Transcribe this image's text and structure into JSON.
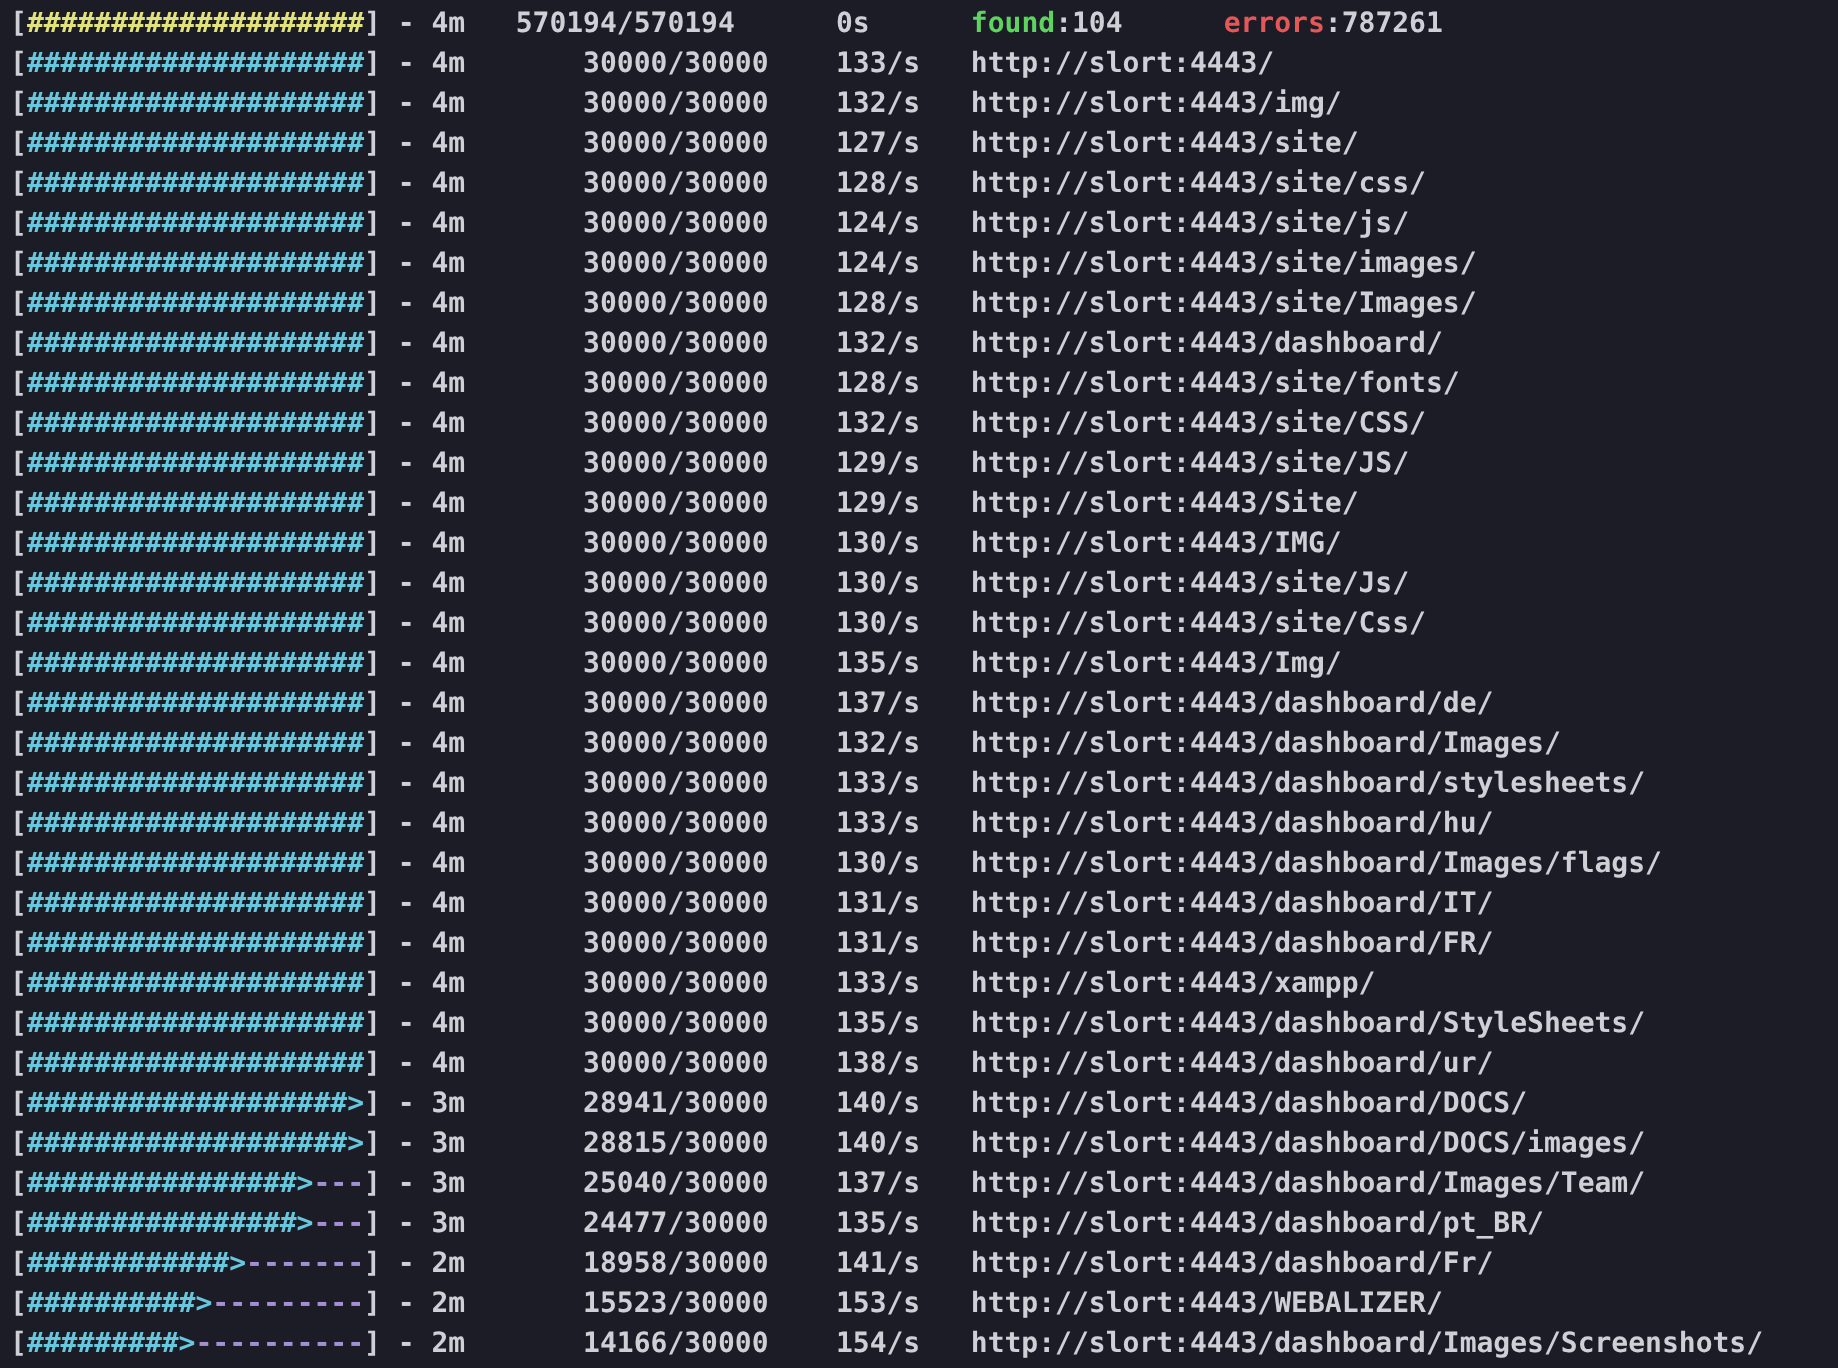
{
  "summary": {
    "open": "[",
    "fill": "####################",
    "close": "]",
    "sep": "-",
    "elapsed": "4m",
    "progress": "570194/570194",
    "rate": "0s",
    "found_label": "found",
    "found_value": ":104",
    "errors_label": "errors",
    "errors_value": ":787261"
  },
  "scans": [
    {
      "open": "[",
      "fill": "####################",
      "close": "]",
      "sep": "-",
      "elapsed": "4m",
      "progress": "30000/30000",
      "rate": "133/s",
      "url": "http://slort:4443/"
    },
    {
      "open": "[",
      "fill": "####################",
      "close": "]",
      "sep": "-",
      "elapsed": "4m",
      "progress": "30000/30000",
      "rate": "132/s",
      "url": "http://slort:4443/img/"
    },
    {
      "open": "[",
      "fill": "####################",
      "close": "]",
      "sep": "-",
      "elapsed": "4m",
      "progress": "30000/30000",
      "rate": "127/s",
      "url": "http://slort:4443/site/"
    },
    {
      "open": "[",
      "fill": "####################",
      "close": "]",
      "sep": "-",
      "elapsed": "4m",
      "progress": "30000/30000",
      "rate": "128/s",
      "url": "http://slort:4443/site/css/"
    },
    {
      "open": "[",
      "fill": "####################",
      "close": "]",
      "sep": "-",
      "elapsed": "4m",
      "progress": "30000/30000",
      "rate": "124/s",
      "url": "http://slort:4443/site/js/"
    },
    {
      "open": "[",
      "fill": "####################",
      "close": "]",
      "sep": "-",
      "elapsed": "4m",
      "progress": "30000/30000",
      "rate": "124/s",
      "url": "http://slort:4443/site/images/"
    },
    {
      "open": "[",
      "fill": "####################",
      "close": "]",
      "sep": "-",
      "elapsed": "4m",
      "progress": "30000/30000",
      "rate": "128/s",
      "url": "http://slort:4443/site/Images/"
    },
    {
      "open": "[",
      "fill": "####################",
      "close": "]",
      "sep": "-",
      "elapsed": "4m",
      "progress": "30000/30000",
      "rate": "132/s",
      "url": "http://slort:4443/dashboard/"
    },
    {
      "open": "[",
      "fill": "####################",
      "close": "]",
      "sep": "-",
      "elapsed": "4m",
      "progress": "30000/30000",
      "rate": "128/s",
      "url": "http://slort:4443/site/fonts/"
    },
    {
      "open": "[",
      "fill": "####################",
      "close": "]",
      "sep": "-",
      "elapsed": "4m",
      "progress": "30000/30000",
      "rate": "132/s",
      "url": "http://slort:4443/site/CSS/"
    },
    {
      "open": "[",
      "fill": "####################",
      "close": "]",
      "sep": "-",
      "elapsed": "4m",
      "progress": "30000/30000",
      "rate": "129/s",
      "url": "http://slort:4443/site/JS/"
    },
    {
      "open": "[",
      "fill": "####################",
      "close": "]",
      "sep": "-",
      "elapsed": "4m",
      "progress": "30000/30000",
      "rate": "129/s",
      "url": "http://slort:4443/Site/"
    },
    {
      "open": "[",
      "fill": "####################",
      "close": "]",
      "sep": "-",
      "elapsed": "4m",
      "progress": "30000/30000",
      "rate": "130/s",
      "url": "http://slort:4443/IMG/"
    },
    {
      "open": "[",
      "fill": "####################",
      "close": "]",
      "sep": "-",
      "elapsed": "4m",
      "progress": "30000/30000",
      "rate": "130/s",
      "url": "http://slort:4443/site/Js/"
    },
    {
      "open": "[",
      "fill": "####################",
      "close": "]",
      "sep": "-",
      "elapsed": "4m",
      "progress": "30000/30000",
      "rate": "130/s",
      "url": "http://slort:4443/site/Css/"
    },
    {
      "open": "[",
      "fill": "####################",
      "close": "]",
      "sep": "-",
      "elapsed": "4m",
      "progress": "30000/30000",
      "rate": "135/s",
      "url": "http://slort:4443/Img/"
    },
    {
      "open": "[",
      "fill": "####################",
      "close": "]",
      "sep": "-",
      "elapsed": "4m",
      "progress": "30000/30000",
      "rate": "137/s",
      "url": "http://slort:4443/dashboard/de/"
    },
    {
      "open": "[",
      "fill": "####################",
      "close": "]",
      "sep": "-",
      "elapsed": "4m",
      "progress": "30000/30000",
      "rate": "132/s",
      "url": "http://slort:4443/dashboard/Images/"
    },
    {
      "open": "[",
      "fill": "####################",
      "close": "]",
      "sep": "-",
      "elapsed": "4m",
      "progress": "30000/30000",
      "rate": "133/s",
      "url": "http://slort:4443/dashboard/stylesheets/"
    },
    {
      "open": "[",
      "fill": "####################",
      "close": "]",
      "sep": "-",
      "elapsed": "4m",
      "progress": "30000/30000",
      "rate": "133/s",
      "url": "http://slort:4443/dashboard/hu/"
    },
    {
      "open": "[",
      "fill": "####################",
      "close": "]",
      "sep": "-",
      "elapsed": "4m",
      "progress": "30000/30000",
      "rate": "130/s",
      "url": "http://slort:4443/dashboard/Images/flags/"
    },
    {
      "open": "[",
      "fill": "####################",
      "close": "]",
      "sep": "-",
      "elapsed": "4m",
      "progress": "30000/30000",
      "rate": "131/s",
      "url": "http://slort:4443/dashboard/IT/"
    },
    {
      "open": "[",
      "fill": "####################",
      "close": "]",
      "sep": "-",
      "elapsed": "4m",
      "progress": "30000/30000",
      "rate": "131/s",
      "url": "http://slort:4443/dashboard/FR/"
    },
    {
      "open": "[",
      "fill": "####################",
      "close": "]",
      "sep": "-",
      "elapsed": "4m",
      "progress": "30000/30000",
      "rate": "133/s",
      "url": "http://slort:4443/xampp/"
    },
    {
      "open": "[",
      "fill": "####################",
      "close": "]",
      "sep": "-",
      "elapsed": "4m",
      "progress": "30000/30000",
      "rate": "135/s",
      "url": "http://slort:4443/dashboard/StyleSheets/"
    },
    {
      "open": "[",
      "fill": "####################",
      "close": "]",
      "sep": "-",
      "elapsed": "4m",
      "progress": "30000/30000",
      "rate": "138/s",
      "url": "http://slort:4443/dashboard/ur/"
    },
    {
      "open": "[",
      "fill": "###################",
      "tip": ">",
      "close": "]",
      "sep": "-",
      "elapsed": "3m",
      "progress": "28941/30000",
      "rate": "140/s",
      "url": "http://slort:4443/dashboard/DOCS/"
    },
    {
      "open": "[",
      "fill": "###################",
      "tip": ">",
      "close": "]",
      "sep": "-",
      "elapsed": "3m",
      "progress": "28815/30000",
      "rate": "140/s",
      "url": "http://slort:4443/dashboard/DOCS/images/"
    },
    {
      "open": "[",
      "fill": "################",
      "tip": ">",
      "empty": "---",
      "close": "]",
      "sep": "-",
      "elapsed": "3m",
      "progress": "25040/30000",
      "rate": "137/s",
      "url": "http://slort:4443/dashboard/Images/Team/"
    },
    {
      "open": "[",
      "fill": "################",
      "tip": ">",
      "empty": "---",
      "close": "]",
      "sep": "-",
      "elapsed": "3m",
      "progress": "24477/30000",
      "rate": "135/s",
      "url": "http://slort:4443/dashboard/pt_BR/"
    },
    {
      "open": "[",
      "fill": "############",
      "tip": ">",
      "empty": "-------",
      "close": "]",
      "sep": "-",
      "elapsed": "2m",
      "progress": "18958/30000",
      "rate": "141/s",
      "url": "http://slort:4443/dashboard/Fr/"
    },
    {
      "open": "[",
      "fill": "##########",
      "tip": ">",
      "empty": "---------",
      "close": "]",
      "sep": "-",
      "elapsed": "2m",
      "progress": "15523/30000",
      "rate": "153/s",
      "url": "http://slort:4443/WEBALIZER/"
    },
    {
      "open": "[",
      "fill": "#########",
      "tip": ">",
      "empty": "----------",
      "close": "]",
      "sep": "-",
      "elapsed": "2m",
      "progress": "14166/30000",
      "rate": "154/s",
      "url": "http://slort:4443/dashboard/Images/Screenshots/"
    }
  ]
}
